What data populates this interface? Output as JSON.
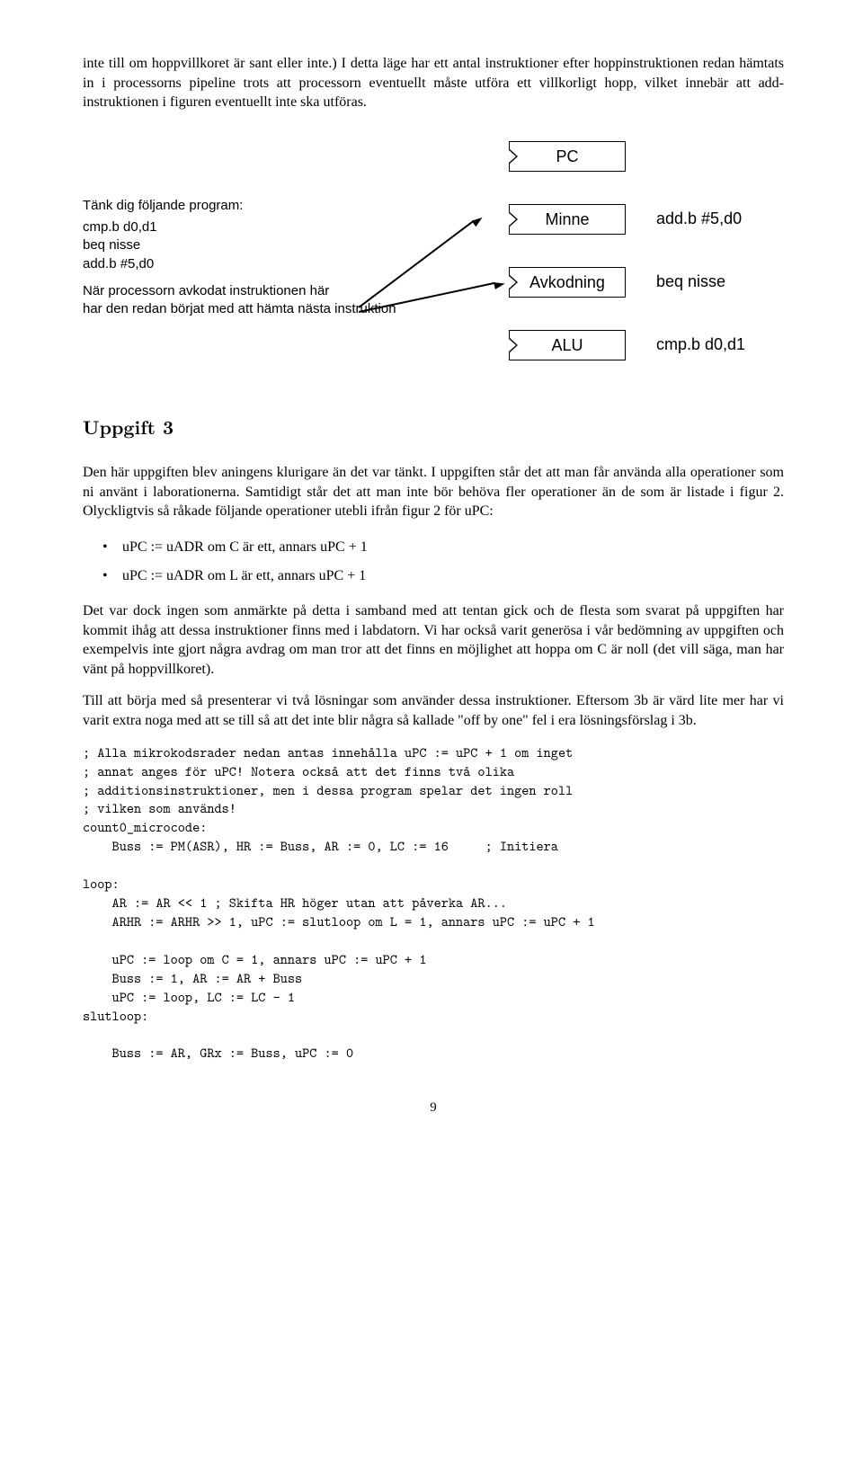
{
  "intro": "inte till om hoppvillkoret är sant eller inte.) I detta läge har ett antal instruktioner efter hoppinstruktionen redan hämtats in i processorns pipeline trots att processorn eventuellt måste utföra ett villkorligt hopp, vilket innebär att add-instruktionen i figuren eventuellt inte ska utföras.",
  "diagram": {
    "prompt": "Tänk dig följande program:",
    "code": [
      "cmp.b d0,d1",
      "beq    nisse",
      "add.b #5,d0"
    ],
    "annot1": "När processorn avkodat instruktionen här",
    "annot2": "har den redan börjat med att hämta nästa instruktion",
    "boxes": {
      "pc": "PC",
      "minne": "Minne",
      "avk": "Avkodning",
      "alu": "ALU"
    },
    "stages": {
      "s1": "add.b #5,d0",
      "s2": "beq nisse",
      "s3": "cmp.b d0,d1"
    }
  },
  "heading": "Uppgift 3",
  "p1": "Den här uppgiften blev aningens klurigare än det var tänkt. I uppgiften står det att man får använda alla operationer som ni använt i laborationerna. Samtidigt står det att man inte bör behöva fler operationer än de som är listade i figur 2. Olyckligtvis så råkade följande operationer utebli ifrån figur 2 för uPC:",
  "bullets": [
    "uPC := uADR om C är ett, annars uPC + 1",
    "uPC := uADR om L är ett, annars uPC + 1"
  ],
  "p2": "Det var dock ingen som anmärkte på detta i samband med att tentan gick och de flesta som svarat på uppgiften har kommit ihåg att dessa instruktioner finns med i labdatorn. Vi har också varit generösa i vår bedömning av uppgiften och exempelvis inte gjort några avdrag om man tror att det finns en möjlighet att hoppa om C är noll (det vill säga, man har vänt på hoppvillkoret).",
  "p3": "Till att börja med så presenterar vi två lösningar som använder dessa instruktioner. Eftersom 3b är värd lite mer har vi varit extra noga med att se till så att det inte blir några så kallade \"off by one\" fel i era lösningsförslag i 3b.",
  "code_block": "; Alla mikrokodsrader nedan antas innehålla uPC := uPC + 1 om inget\n; annat anges för uPC! Notera också att det finns två olika\n; additionsinstruktioner, men i dessa program spelar det ingen roll\n; vilken som används!\ncount0_microcode:\n    Buss := PM(ASR), HR := Buss, AR := 0, LC := 16     ; Initiera\n\nloop:\n    AR := AR << 1 ; Skifta HR höger utan att påverka AR...\n    ARHR := ARHR >> 1, uPC := slutloop om L = 1, annars uPC := uPC + 1\n\n    uPC := loop om C = 1, annars uPC := uPC + 1\n    Buss := 1, AR := AR + Buss\n    uPC := loop, LC := LC - 1\nslutloop:\n\n    Buss := AR, GRx := Buss, uPC := 0",
  "page_num": "9"
}
